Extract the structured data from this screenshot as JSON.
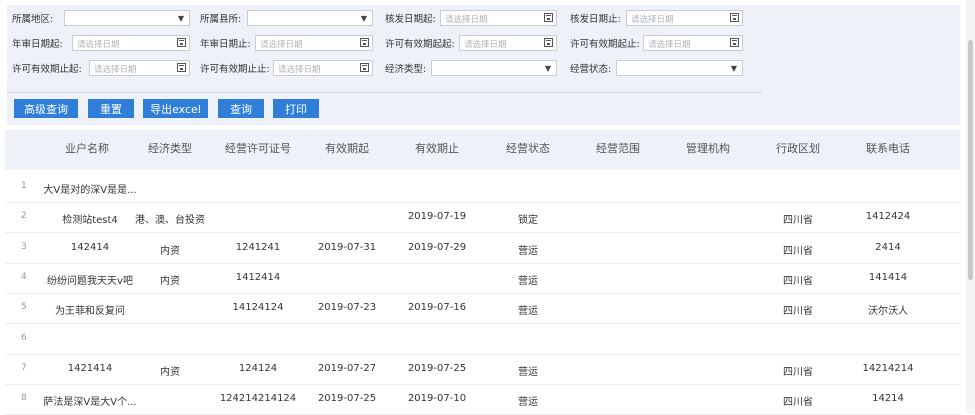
{
  "filters": {
    "region": {
      "label": "所属地区:",
      "value": ""
    },
    "county": {
      "label": "所属县所:",
      "value": ""
    },
    "issue_start": {
      "label": "核发日期起:",
      "placeholder": "请选择日期"
    },
    "issue_end": {
      "label": "核发日期止:",
      "placeholder": "请选择日期"
    },
    "review_start": {
      "label": "年审日期起:",
      "placeholder": "请选择日期"
    },
    "review_end": {
      "label": "年审日期止:",
      "placeholder": "请选择日期"
    },
    "valid_from_start": {
      "label": "许可有效期起起:",
      "placeholder": "请选择日期"
    },
    "valid_from_end": {
      "label": "许可有效期起止:",
      "placeholder": "请选择日期"
    },
    "valid_to_start": {
      "label": "许可有效期止起:",
      "placeholder": "请选择日期"
    },
    "valid_to_end": {
      "label": "许可有效期止止:",
      "placeholder": "请选择日期"
    },
    "econ_type": {
      "label": "经济类型:",
      "value": ""
    },
    "status": {
      "label": "经营状态:",
      "value": ""
    }
  },
  "buttons": {
    "advanced": "高级查询",
    "reset": "重置",
    "export": "导出excel",
    "query": "查询",
    "print": "打印"
  },
  "columns": [
    "业户名称",
    "经济类型",
    "经营许可证号",
    "有效期起",
    "有效期止",
    "经营状态",
    "经营范围",
    "管理机构",
    "行政区划",
    "联系电话"
  ],
  "rows": [
    {
      "no": "1",
      "name": "大V是对的深V是是...",
      "type": "",
      "license": "",
      "start": "",
      "end": "",
      "status": "",
      "scope": "",
      "org": "",
      "area": "",
      "phone": ""
    },
    {
      "no": "2",
      "name": "检测站test4",
      "type": "港、澳、台投资",
      "license": "",
      "start": "",
      "end": "2019-07-19",
      "status": "锁定",
      "scope": "",
      "org": "",
      "area": "四川省",
      "phone": "1412424"
    },
    {
      "no": "3",
      "name": "142414",
      "type": "内资",
      "license": "1241241",
      "start": "2019-07-31",
      "end": "2019-07-29",
      "status": "营运",
      "scope": "",
      "org": "",
      "area": "四川省",
      "phone": "2414"
    },
    {
      "no": "4",
      "name": "纷纷问题我天天v吧",
      "type": "内资",
      "license": "1412414",
      "start": "",
      "end": "",
      "status": "营运",
      "scope": "",
      "org": "",
      "area": "四川省",
      "phone": "141414"
    },
    {
      "no": "5",
      "name": "为王菲和反复问",
      "type": "",
      "license": "14124124",
      "start": "2019-07-23",
      "end": "2019-07-16",
      "status": "营运",
      "scope": "",
      "org": "",
      "area": "四川省",
      "phone": "沃尔沃人"
    },
    {
      "no": "6",
      "name": "",
      "type": "",
      "license": "",
      "start": "",
      "end": "",
      "status": "",
      "scope": "",
      "org": "",
      "area": "",
      "phone": ""
    },
    {
      "no": "7",
      "name": "1421414",
      "type": "内资",
      "license": "124124",
      "start": "2019-07-27",
      "end": "2019-07-25",
      "status": "营运",
      "scope": "",
      "org": "",
      "area": "四川省",
      "phone": "14214214"
    },
    {
      "no": "8",
      "name": "萨法是深V是大V个...",
      "type": "",
      "license": "124214214124",
      "start": "2019-07-25",
      "end": "2019-07-10",
      "status": "营运",
      "scope": "",
      "org": "",
      "area": "四川省",
      "phone": "14214"
    }
  ]
}
